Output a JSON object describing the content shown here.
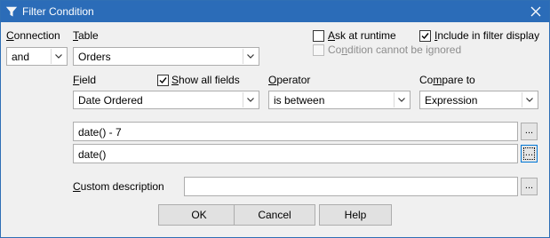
{
  "window": {
    "title": "Filter Condition",
    "icon": "filter-funnel-icon",
    "close_icon": "close-icon"
  },
  "connection": {
    "label": "Connection",
    "mnemonic": "C",
    "label_rest": "onnection",
    "value": "and"
  },
  "table": {
    "label": "Table",
    "mnemonic": "T",
    "label_rest": "able",
    "value": "Orders"
  },
  "ask_at_runtime": {
    "label_mnemonic": "A",
    "label_rest": "sk at runtime",
    "checked": false
  },
  "include_in_filter_display": {
    "label_mnemonic": "I",
    "label_rest": "nclude in filter display",
    "checked": true
  },
  "condition_cannot_be_ignored": {
    "label_prefix": "Co",
    "label_mnemonic": "n",
    "label_rest": "dition cannot be ignored",
    "checked": false,
    "enabled": false
  },
  "field": {
    "label_mnemonic": "F",
    "label_rest": "ield",
    "value": "Date Ordered"
  },
  "show_all_fields": {
    "label_mnemonic": "S",
    "label_rest": "how all fields",
    "checked": true
  },
  "operator": {
    "label_mnemonic": "O",
    "label_rest": "perator",
    "value": "is between"
  },
  "compare_to": {
    "label_prefix": "Co",
    "label_mnemonic": "m",
    "label_rest": "pare to",
    "value": "Expression"
  },
  "expression1": {
    "value": "date() - 7",
    "button": "..."
  },
  "expression2": {
    "value": "date()",
    "button": "..."
  },
  "custom_description": {
    "label_mnemonic": "C",
    "label_rest": "ustom description",
    "value": "",
    "button": "..."
  },
  "buttons": {
    "ok": "OK",
    "cancel": "Cancel",
    "help": "Help"
  },
  "colors": {
    "titlebar": "#2b6cb8",
    "dialog_bg": "#f0f0f0",
    "focus_border": "#0078d7"
  }
}
